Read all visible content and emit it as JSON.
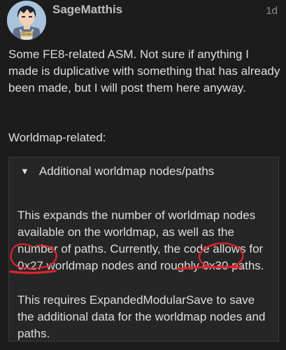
{
  "post": {
    "username": "SageMatthis",
    "date": "1d",
    "avatar_badge": "Eirika",
    "intro": "Some FE8-related ASM. Not sure if anything I made is duplicative with something that has already been made, but I will post them here anyway.",
    "section_heading": "Worldmap-related:",
    "details": {
      "arrow": "▼",
      "summary": "Additional worldmap nodes/paths",
      "paragraph1": "This expands the number of worldmap nodes available on the worldmap, as well as the number of paths. Currently, the code allows for 0x27 worldmap nodes and roughly 0x30 paths.",
      "paragraph2": "This requires ExpandedModularSave to save the additional data for the worldmap nodes and paths."
    }
  },
  "colors": {
    "background": "#1c1c1c",
    "details_background": "#262626",
    "annotation_red": "#e0242b"
  }
}
